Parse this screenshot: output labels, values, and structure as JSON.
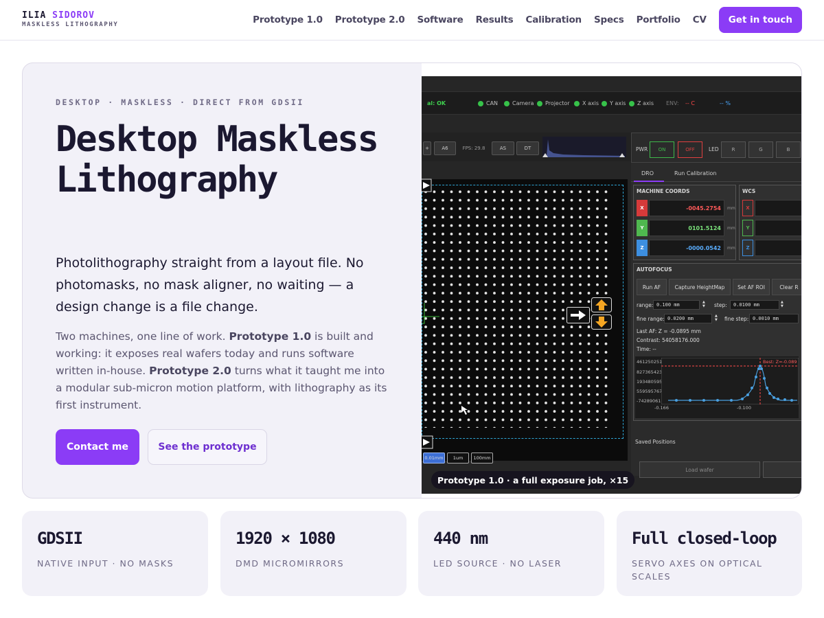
{
  "header": {
    "brand_first": "ILIA",
    "brand_last": "SIDOROV",
    "brand_sub": "MASKLESS LITHOGRAPHY",
    "nav": [
      "Prototype 1.0",
      "Prototype 2.0",
      "Software",
      "Results",
      "Calibration",
      "Specs",
      "Portfolio",
      "CV"
    ],
    "cta": "Get in touch"
  },
  "hero": {
    "eyebrow": "DESKTOP · MASKLESS · DIRECT FROM GDSII",
    "title": "Desktop Maskless Lithography",
    "lead": "Photolithography straight from a layout file. No photomasks, no mask aligner, no waiting — a design change is a file change.",
    "body_1": "Two machines, one line of work. ",
    "body_bold_1": "Prototype 1.0",
    "body_2": " is built and working: it exposes real wafers today and runs software written in-house. ",
    "body_bold_2": "Prototype 2.0",
    "body_3": " turns what it taught me into a modular sub-micron motion platform, with lithography as its first instrument.",
    "btn_primary": "Contact me",
    "btn_secondary": "See the prototype",
    "caption": "Prototype 1.0 · a full exposure job, ×15"
  },
  "screenshot": {
    "status_ok": "al: OK",
    "indicators": [
      "CAN",
      "Camera",
      "Projector",
      "X axis",
      "Y axis",
      "Z axis"
    ],
    "env_label": "ENV:",
    "env_c": "-- C",
    "env_pct": "-- %",
    "tb_plus": "+",
    "tb_a6": "A6",
    "fps": "FPS: 29.8",
    "tb_as": "AS",
    "tb_dt": "DT",
    "pwr": "PWR",
    "on": "ON",
    "off": "OFF",
    "led": "LED",
    "rgb": [
      "R",
      "G",
      "B"
    ],
    "tab_dro": "DRO",
    "tab_calib": "Run Calibration",
    "machine_coords": "MACHINE COORDS",
    "wcs": "WCS",
    "axes": [
      "X",
      "Y",
      "Z"
    ],
    "x_val": "-0045.2754",
    "y_val": "0101.5124",
    "z_val": "-0000.0542",
    "unit": "mm",
    "autofocus": "AUTOFOCUS",
    "run_af": "Run AF",
    "capture": "Capture HeightMap",
    "set_roi": "Set AF ROI",
    "clear": "Clear R",
    "range_lbl": "range:",
    "range_val": "0.100 mm",
    "step_lbl": "step:",
    "step_val": "0.0100 mm",
    "fine_range_lbl": "fine range:",
    "fine_range_val": "0.0200 mm",
    "fine_step_lbl": "fine step:",
    "fine_step_val": "0.0010 mm",
    "last_af": "Last AF: Z = -0.0895 mm",
    "contrast": "Contrast: 54058176.000",
    "time": "Time: --",
    "plot_y": [
      "461250251",
      "827365423",
      "193480595",
      "559595767",
      "-74289061"
    ],
    "plot_x": [
      "-0.166",
      "-0.100"
    ],
    "best": "Best: Z=-0.089",
    "saved": "Saved Positions",
    "load": "Load wafer",
    "zoom": [
      "0.01mm",
      "1um",
      "100mm"
    ]
  },
  "stats": [
    {
      "value": "GDSII",
      "label": "NATIVE INPUT · NO MASKS"
    },
    {
      "value": "1920 × 1080",
      "label": "DMD MICROMIRRORS"
    },
    {
      "value": "440 nm",
      "label": "LED SOURCE · NO LASER"
    },
    {
      "value": "Full closed-loop",
      "label": "SERVO AXES ON OPTICAL SCALES"
    }
  ],
  "colors": {
    "accent": "#8b3cf6",
    "ink": "#1b1830",
    "panel": "#f2f1f8",
    "roi": "#2ea6d6"
  }
}
